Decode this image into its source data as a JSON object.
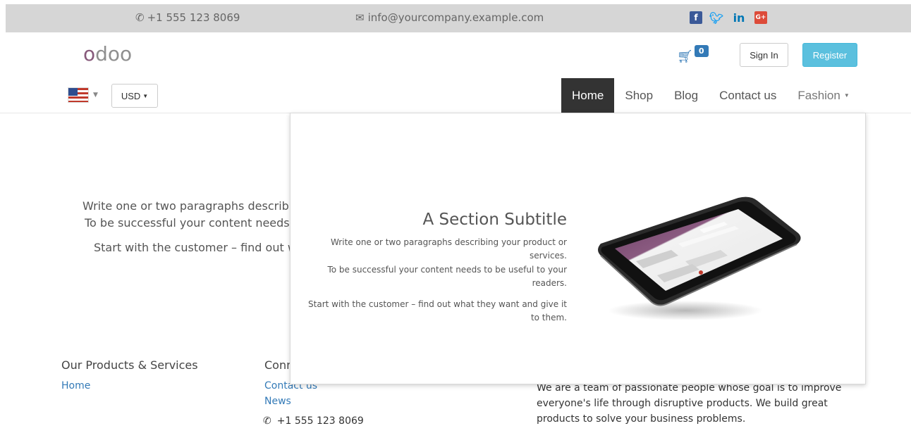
{
  "topbar": {
    "phone": "+1 555 123 8069",
    "email": "info@yourcompany.example.com",
    "social": [
      "facebook-icon",
      "twitter-icon",
      "linkedin-icon",
      "google-plus-icon"
    ]
  },
  "header": {
    "logo_first": "o",
    "logo_rest": "doo",
    "cart_count": "0",
    "sign_in": "Sign In",
    "register": "Register",
    "currency": "USD"
  },
  "nav": {
    "items": [
      {
        "label": "Home",
        "active": true
      },
      {
        "label": "Shop"
      },
      {
        "label": "Blog"
      },
      {
        "label": "Contact us"
      },
      {
        "label": "Fashion"
      }
    ]
  },
  "background": {
    "line1": "Write one or two paragraphs describi",
    "line2": "To be successful your content needs",
    "line3": "Start with the customer – find out w"
  },
  "footer": {
    "products_title": "Our Products & Services",
    "home_link": "Home",
    "connect_title": "Conn",
    "contact_link": "Contact us",
    "news_link": "News",
    "phone": "+1 555 123 8069",
    "about": "We are a team of passionate people whose goal is to improve everyone's life through disruptive products. We build great products to solve your business problems."
  },
  "dropdown": {
    "subtitle": "A Section Subtitle",
    "p1": "Write one or two paragraphs describing your product or services.",
    "p2": "To be successful your content needs to be useful to your readers.",
    "p3": "Start with the customer – find out what they want and give it to them."
  },
  "colors": {
    "brand": "#875a7b",
    "link": "#337ab7",
    "register": "#5bc0de",
    "nav_active": "#333333"
  }
}
